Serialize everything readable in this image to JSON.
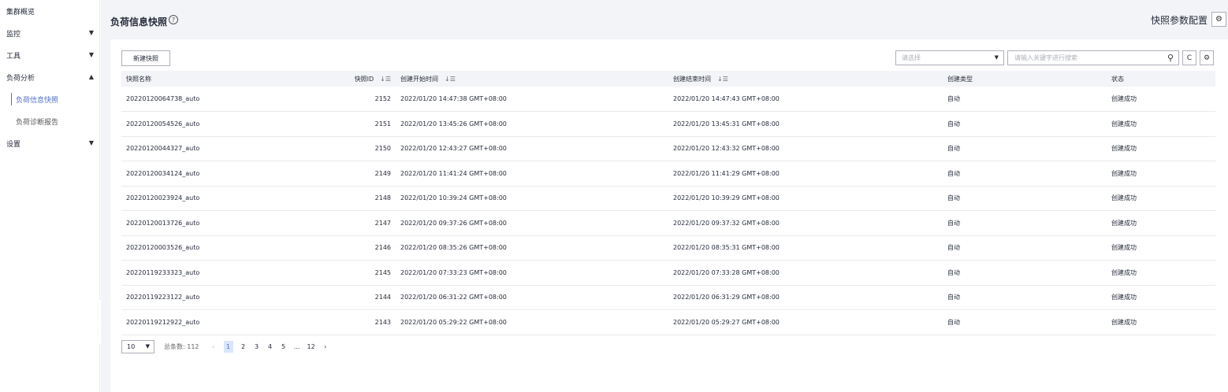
{
  "sidebar": {
    "items": [
      {
        "label": "集群概览"
      },
      {
        "label": "监控"
      },
      {
        "label": "工具"
      },
      {
        "label": "负荷分析"
      },
      {
        "label": "负荷信息快照"
      },
      {
        "label": "负荷诊断报告"
      },
      {
        "label": "设置"
      }
    ]
  },
  "header": {
    "title": "负荷信息快照",
    "help_icon": "?",
    "config_label": "快照参数配置"
  },
  "toolbar": {
    "new_button": "新建快照",
    "select_placeholder": "请选择",
    "search_placeholder": "请输入关键字进行搜索"
  },
  "table": {
    "columns": [
      "快照名称",
      "快照ID",
      "创建开始时间",
      "创建结束时间",
      "创建类型",
      "状态"
    ],
    "rows": [
      {
        "name": "20220120064738_auto",
        "id": "2152",
        "start": "2022/01/20 14:47:38 GMT+08:00",
        "end": "2022/01/20 14:47:43 GMT+08:00",
        "type": "自动",
        "status": "创建成功"
      },
      {
        "name": "20220120054526_auto",
        "id": "2151",
        "start": "2022/01/20 13:45:26 GMT+08:00",
        "end": "2022/01/20 13:45:31 GMT+08:00",
        "type": "自动",
        "status": "创建成功"
      },
      {
        "name": "20220120044327_auto",
        "id": "2150",
        "start": "2022/01/20 12:43:27 GMT+08:00",
        "end": "2022/01/20 12:43:32 GMT+08:00",
        "type": "自动",
        "status": "创建成功"
      },
      {
        "name": "20220120034124_auto",
        "id": "2149",
        "start": "2022/01/20 11:41:24 GMT+08:00",
        "end": "2022/01/20 11:41:29 GMT+08:00",
        "type": "自动",
        "status": "创建成功"
      },
      {
        "name": "20220120023924_auto",
        "id": "2148",
        "start": "2022/01/20 10:39:24 GMT+08:00",
        "end": "2022/01/20 10:39:29 GMT+08:00",
        "type": "自动",
        "status": "创建成功"
      },
      {
        "name": "20220120013726_auto",
        "id": "2147",
        "start": "2022/01/20 09:37:26 GMT+08:00",
        "end": "2022/01/20 09:37:32 GMT+08:00",
        "type": "自动",
        "status": "创建成功"
      },
      {
        "name": "20220120003526_auto",
        "id": "2146",
        "start": "2022/01/20 08:35:26 GMT+08:00",
        "end": "2022/01/20 08:35:31 GMT+08:00",
        "type": "自动",
        "status": "创建成功"
      },
      {
        "name": "20220119233323_auto",
        "id": "2145",
        "start": "2022/01/20 07:33:23 GMT+08:00",
        "end": "2022/01/20 07:33:28 GMT+08:00",
        "type": "自动",
        "status": "创建成功"
      },
      {
        "name": "20220119223122_auto",
        "id": "2144",
        "start": "2022/01/20 06:31:22 GMT+08:00",
        "end": "2022/01/20 06:31:29 GMT+08:00",
        "type": "自动",
        "status": "创建成功"
      },
      {
        "name": "20220119212922_auto",
        "id": "2143",
        "start": "2022/01/20 05:29:22 GMT+08:00",
        "end": "2022/01/20 05:29:27 GMT+08:00",
        "type": "自动",
        "status": "创建成功"
      }
    ]
  },
  "pagination": {
    "page_size": "10",
    "total": "总条数: 112",
    "pages": [
      "1",
      "2",
      "3",
      "4",
      "5",
      "...",
      "12"
    ],
    "current": "1"
  },
  "icons": {
    "chevron_down": "▼",
    "chevron_up": "▲",
    "chevron_left": "‹",
    "chevron_right": "›",
    "collapse": "◂",
    "sort": "↓☰",
    "refresh": "C",
    "settings": "⚙",
    "search": "⚲"
  },
  "colors": {
    "accent": "#526ecc",
    "background": "#f3f4f7"
  }
}
